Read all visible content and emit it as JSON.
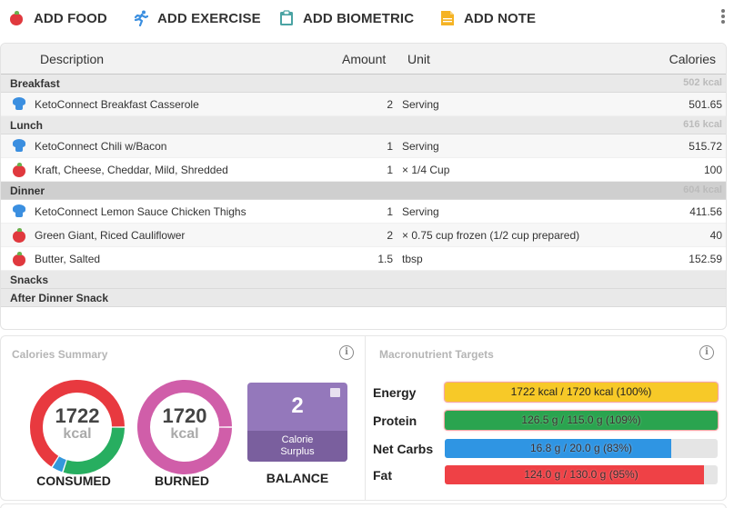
{
  "toolbar": {
    "add_food": "ADD FOOD",
    "add_exercise": "ADD EXERCISE",
    "add_biometric": "ADD BIOMETRIC",
    "add_note": "ADD NOTE",
    "icons": {
      "add_food": "apple-icon",
      "add_exercise": "running-icon",
      "add_biometric": "clipboard-icon",
      "add_note": "note-icon",
      "more": "kebab-menu-icon"
    }
  },
  "diary": {
    "columns": {
      "description": "Description",
      "amount": "Amount",
      "unit": "Unit",
      "calories": "Calories"
    },
    "groups": [
      {
        "name": "Breakfast",
        "kcal": "502 kcal",
        "items": [
          {
            "icon": "chef-hat-icon",
            "description": "KetoConnect Breakfast Casserole",
            "amount": "2",
            "unit": "Serving",
            "calories": "501.65"
          }
        ]
      },
      {
        "name": "Lunch",
        "kcal": "616 kcal",
        "items": [
          {
            "icon": "chef-hat-icon",
            "description": "KetoConnect Chili w/Bacon",
            "amount": "1",
            "unit": "Serving",
            "calories": "515.72"
          },
          {
            "icon": "apple-icon",
            "description": "Kraft, Cheese, Cheddar, Mild, Shredded",
            "amount": "1",
            "unit": "× 1/4 Cup",
            "calories": "100"
          }
        ]
      },
      {
        "name": "Dinner",
        "kcal": "604 kcal",
        "items": [
          {
            "icon": "chef-hat-icon",
            "description": "KetoConnect Lemon Sauce Chicken Thighs",
            "amount": "1",
            "unit": "Serving",
            "calories": "411.56"
          },
          {
            "icon": "apple-icon",
            "description": "Green Giant, Riced Cauliflower",
            "amount": "2",
            "unit": "× 0.75 cup frozen (1/2 cup prepared)",
            "calories": "40"
          },
          {
            "icon": "apple-icon",
            "description": "Butter, Salted",
            "amount": "1.5",
            "unit": "tbsp",
            "calories": "152.59"
          }
        ]
      },
      {
        "name": "Snacks",
        "kcal": "",
        "items": []
      },
      {
        "name": "After Dinner Snack",
        "kcal": "",
        "items": []
      }
    ]
  },
  "calories_summary": {
    "title": "Calories Summary",
    "consumed": {
      "value": "1722",
      "unit": "kcal",
      "label": "CONSUMED",
      "segments": [
        {
          "name": "protein",
          "fraction": 0.3,
          "color": "#27ae60"
        },
        {
          "name": "carbs",
          "fraction": 0.04,
          "color": "#3498db"
        },
        {
          "name": "fat",
          "fraction": 0.66,
          "color": "#e8393f"
        }
      ]
    },
    "burned": {
      "value": "1720",
      "unit": "kcal",
      "label": "BURNED",
      "color": "#d05ea9"
    },
    "balance": {
      "value": "2",
      "sub_line1": "Calorie",
      "sub_line2": "Surplus",
      "label": "BALANCE"
    }
  },
  "macro_targets": {
    "title": "Macronutrient Targets",
    "rows": [
      {
        "name": "Energy",
        "text": "1722 kcal / 1720 kcal (100%)",
        "percent": 100,
        "color": "#f7c928",
        "over": true
      },
      {
        "name": "Protein",
        "text": "126.5 g / 115.0 g (109%)",
        "percent": 109,
        "color": "#2aa44f",
        "over": true
      },
      {
        "name": "Net Carbs",
        "text": "16.8 g / 20.0 g (83%)",
        "percent": 83,
        "color": "#2f95e3",
        "over": false
      },
      {
        "name": "Fat",
        "text": "124.0 g / 130.0 g (95%)",
        "percent": 95,
        "color": "#ef4146",
        "over": false
      }
    ]
  }
}
